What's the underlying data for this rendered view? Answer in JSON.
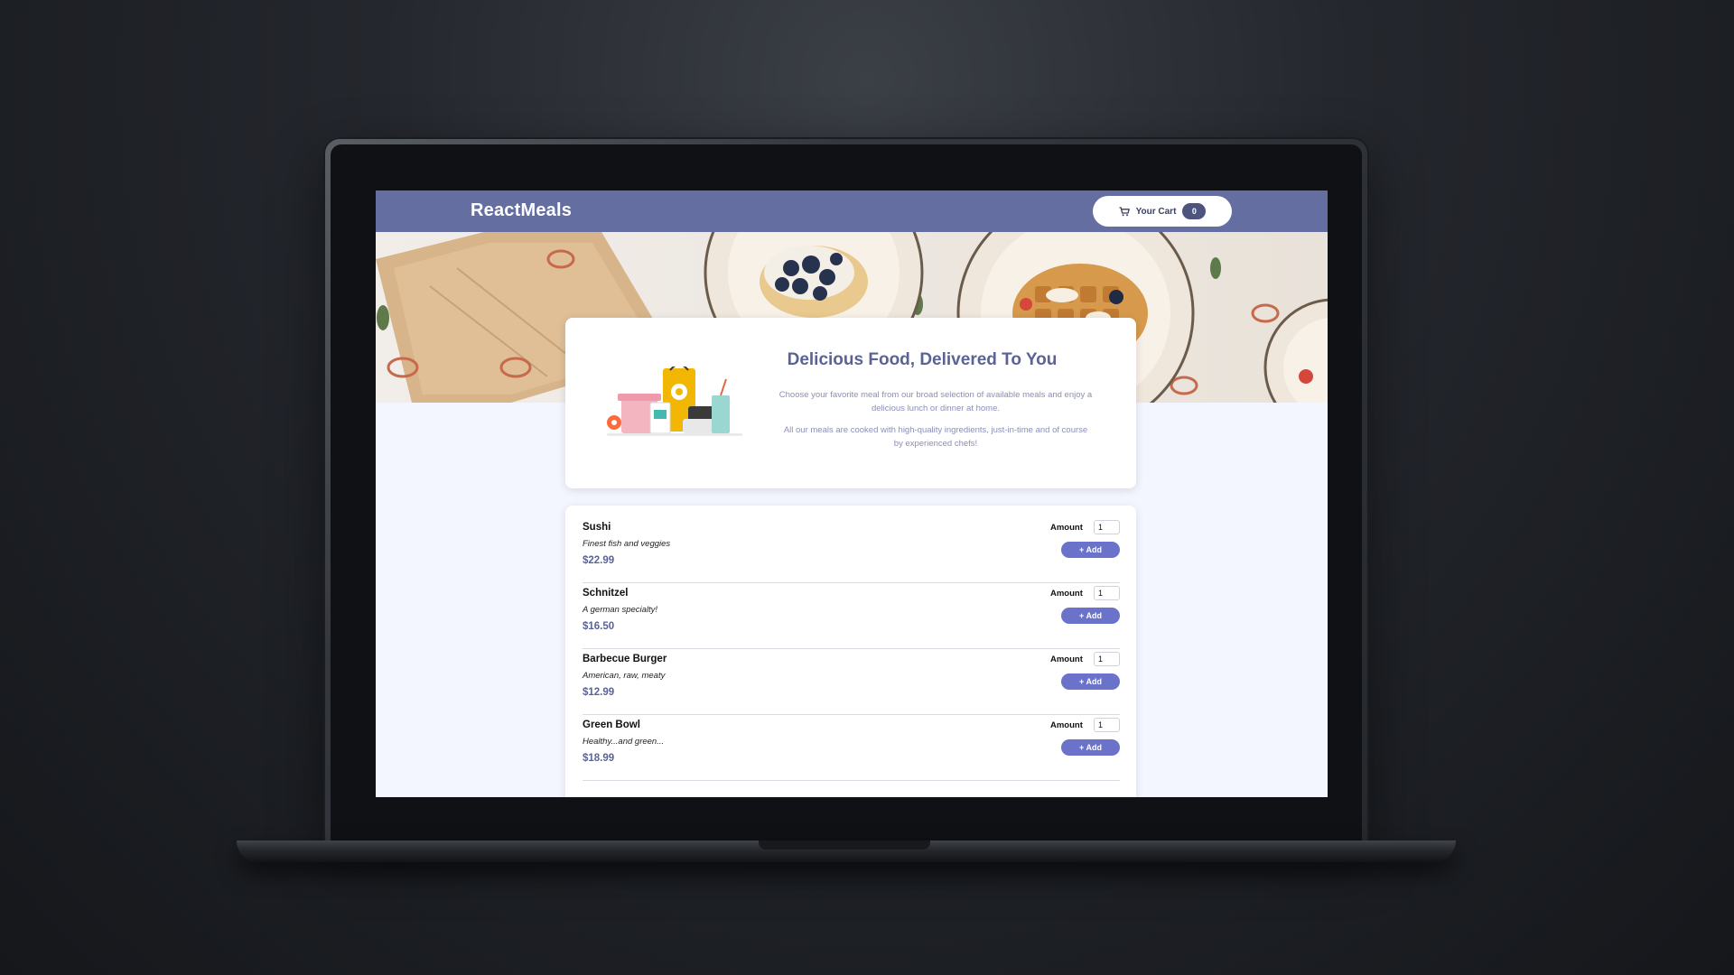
{
  "header": {
    "title": "ReactMeals",
    "cart_label": "Your Cart",
    "cart_count": "0",
    "cart_icon": "cart-icon"
  },
  "summary": {
    "title": "Delicious Food, Delivered To You",
    "paragraph1": "Choose your favorite meal from our broad selection of available meals and enjoy a delicious lunch or dinner at home.",
    "paragraph2": "All our meals are cooked with high-quality ingredients, just-in-time and of course by experienced chefs!"
  },
  "meals": [
    {
      "name": "Sushi",
      "description": "Finest fish and veggies",
      "price": "$22.99",
      "amount_label": "Amount",
      "amount_value": "1",
      "add_label": "+ Add"
    },
    {
      "name": "Schnitzel",
      "description": "A german specialty!",
      "price": "$16.50",
      "amount_label": "Amount",
      "amount_value": "1",
      "add_label": "+ Add"
    },
    {
      "name": "Barbecue Burger",
      "description": "American, raw, meaty",
      "price": "$12.99",
      "amount_label": "Amount",
      "amount_value": "1",
      "add_label": "+ Add"
    },
    {
      "name": "Green Bowl",
      "description": "Healthy...and green...",
      "price": "$18.99",
      "amount_label": "Amount",
      "amount_value": "1",
      "add_label": "+ Add"
    }
  ],
  "colors": {
    "header_bg": "#646ea0",
    "accent": "#6a72c9",
    "price": "#5b6394",
    "page_bg": "#f3f6fe"
  }
}
